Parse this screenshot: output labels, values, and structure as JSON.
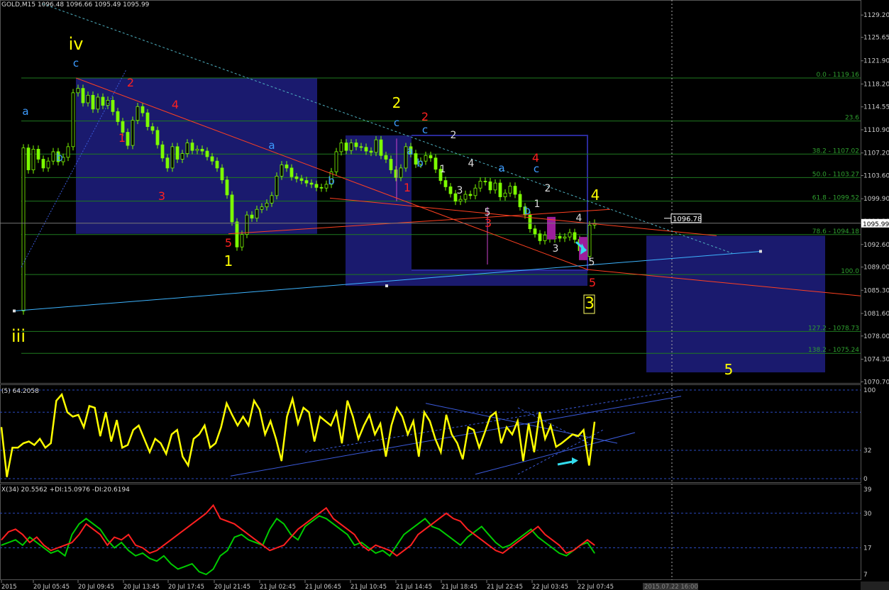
{
  "header": {
    "main": "GOLD,M15  1096.48 1096.66 1095.49 1095.99",
    "rsi": "(5) 64.2058",
    "adx": "X(34) 20.5562 +DI:15.0976 -DI:20.6194"
  },
  "chart_data": [
    {
      "type": "line",
      "panel": "price",
      "title": "GOLD,M15  1096.48 1096.66 1095.49 1095.99",
      "bid_label": "1095.99",
      "price_tag": "1096.78",
      "ylim": [
        1070.4,
        1131.6
      ],
      "yticks": [
        "1129.20",
        "1125.65",
        "1121.90",
        "1118.20",
        "1114.55",
        "1110.90",
        "1107.20",
        "1103.60",
        "1099.90",
        "1096.30",
        "1092.60",
        "1089.00",
        "1085.30",
        "1081.60",
        "1078.00",
        "1074.30",
        "1070.70"
      ],
      "ytick_values": [
        1129.2,
        1125.65,
        1121.9,
        1118.2,
        1114.55,
        1110.9,
        1107.2,
        1103.6,
        1099.9,
        1096.3,
        1092.6,
        1089.0,
        1085.3,
        1081.6,
        1078.0,
        1074.3,
        1070.7
      ],
      "xticks": [
        "2015",
        "20 Jul 05:45",
        "20 Jul 09:45",
        "20 Jul 13:45",
        "20 Jul 17:45",
        "20 Jul 21:45",
        "21 Jul 02:45",
        "21 Jul 06:45",
        "21 Jul 10:45",
        "21 Jul 14:45",
        "21 Jul 18:45",
        "21 Jul 22:45",
        "22 Jul 03:45",
        "22 Jul 07:45"
      ],
      "x_cursor_label": "2015.07.22 16:00",
      "close": [
        1082.0,
        1108.0,
        1104.5,
        1107.8,
        1106.2,
        1104.8,
        1105.9,
        1107.4,
        1105.8,
        1106.5,
        1108.2,
        1116.8,
        1117.5,
        1115.2,
        1116.4,
        1114.2,
        1116.1,
        1114.8,
        1115.6,
        1113.8,
        1112.2,
        1110.5,
        1108.4,
        1112.4,
        1114.6,
        1113.6,
        1111.4,
        1110.8,
        1108.5,
        1106.4,
        1104.8,
        1108.2,
        1106.2,
        1107.1,
        1108.8,
        1107.6,
        1107.8,
        1107.5,
        1106.6,
        1105.9,
        1104.8,
        1102.9,
        1100.5,
        1096.2,
        1092.2,
        1094.2,
        1097.3,
        1096.8,
        1098.2,
        1098.6,
        1099.2,
        1100.4,
        1103.5,
        1105.3,
        1104.8,
        1103.4,
        1103.1,
        1102.8,
        1102.4,
        1102.2,
        1101.7,
        1101.6,
        1102.2,
        1104.2,
        1107.4,
        1108.8,
        1107.6,
        1108.8,
        1108.2,
        1108.1,
        1107.5,
        1107.3,
        1109.3,
        1106.8,
        1106.2,
        1104.5,
        1103.3,
        1104.8,
        1108.2,
        1107.1,
        1105.4,
        1105.9,
        1106.8,
        1106.4,
        1104.6,
        1102.8,
        1101.8,
        1100.7,
        1099.5,
        1099.8,
        1100.6,
        1100.4,
        1101.6,
        1102.7,
        1102.6,
        1101.3,
        1102.4,
        1100.2,
        1100.8,
        1101.9,
        1100.6,
        1098.6,
        1097.3,
        1095.1,
        1094.3,
        1093.2,
        1094.1,
        1093.5,
        1093.9,
        1093.6,
        1093.8,
        1094.5,
        1093.4,
        1091.6,
        1090.7,
        1095.7,
        1096.0
      ],
      "fib_levels": [
        {
          "label": "0.0 - 1119.16",
          "value": 1119.16
        },
        {
          "label": "23.6",
          "value": 1112.3
        },
        {
          "label": "38.2 - 1107.02",
          "value": 1107.02
        },
        {
          "label": "50.0 - 1103.27",
          "value": 1103.27
        },
        {
          "label": "61.8 - 1099.52",
          "value": 1099.52
        },
        {
          "label": "78.6 - 1094.18",
          "value": 1094.18
        },
        {
          "label": "100.0",
          "value": 1087.8
        },
        {
          "label": "127.2 - 1078.73",
          "value": 1078.73
        },
        {
          "label": "138.2 - 1075.24",
          "value": 1075.24
        }
      ],
      "wave_labels": [
        {
          "text": "iv",
          "color": "#ffff00"
        },
        {
          "text": "iii",
          "color": "#ffff00"
        },
        {
          "text": "c",
          "color": "#3d9bff"
        },
        {
          "text": "a",
          "color": "#3d9bff"
        },
        {
          "text": "b",
          "color": "#3d9bff"
        },
        {
          "text": "2",
          "color": "#ff2020"
        },
        {
          "text": "4",
          "color": "#ff2020"
        },
        {
          "text": "1",
          "color": "#ff2020"
        },
        {
          "text": "3",
          "color": "#ff2020"
        },
        {
          "text": "5",
          "color": "#ff2020"
        },
        {
          "text": "1",
          "color": "#ffff00"
        },
        {
          "text": "a",
          "color": "#3d9bff"
        },
        {
          "text": "b",
          "color": "#3d9bff"
        },
        {
          "text": "2",
          "color": "#ffff00"
        },
        {
          "text": "c",
          "color": "#3d9bff"
        },
        {
          "text": "2",
          "color": "#ff2020"
        },
        {
          "text": "c",
          "color": "#3d9bff"
        },
        {
          "text": "a",
          "color": "#3d9bff"
        },
        {
          "text": "1",
          "color": "#ff2020"
        },
        {
          "text": "b",
          "color": "#3d9bff"
        },
        {
          "text": "2",
          "color": "#dddddd"
        },
        {
          "text": "1",
          "color": "#dddddd"
        },
        {
          "text": "4",
          "color": "#dddddd"
        },
        {
          "text": "3",
          "color": "#dddddd"
        },
        {
          "text": "5",
          "color": "#dddddd"
        },
        {
          "text": "3",
          "color": "#ff2020"
        },
        {
          "text": "a",
          "color": "#3d9bff"
        },
        {
          "text": "4",
          "color": "#ff2020"
        },
        {
          "text": "c",
          "color": "#3d9bff"
        },
        {
          "text": "2",
          "color": "#dddddd"
        },
        {
          "text": "1",
          "color": "#dddddd"
        },
        {
          "text": "b",
          "color": "#3d9bff"
        },
        {
          "text": "3",
          "color": "#dddddd"
        },
        {
          "text": "4",
          "color": "#dddddd"
        },
        {
          "text": "5",
          "color": "#dddddd"
        },
        {
          "text": "4",
          "color": "#ffff00"
        },
        {
          "text": "5",
          "color": "#ff2020"
        },
        {
          "text": "3",
          "color": "#ffff00"
        },
        {
          "text": "5",
          "color": "#ffff00"
        }
      ],
      "colors": {
        "candles": "#7CFC00",
        "fib": "#1f7a1f",
        "box": "#1a1a6e",
        "trend_red": "#ff4020",
        "trend_blue": "#3db4ff",
        "highlight": "#9b1f9b"
      }
    },
    {
      "type": "line",
      "panel": "rsi",
      "title": "(5) 64.2058",
      "ylim": [
        0,
        100
      ],
      "yticks": [
        "100",
        "32",
        "0"
      ],
      "ytick_values": [
        100,
        32,
        0
      ],
      "levels": [
        100,
        75,
        32,
        0
      ],
      "values": [
        58,
        2,
        35,
        35,
        40,
        42,
        38,
        45,
        35,
        40,
        88,
        95,
        75,
        70,
        72,
        58,
        82,
        80,
        48,
        75,
        42,
        66,
        35,
        38,
        55,
        60,
        45,
        30,
        45,
        40,
        28,
        50,
        55,
        25,
        15,
        45,
        50,
        60,
        35,
        40,
        58,
        85,
        72,
        60,
        70,
        60,
        88,
        78,
        50,
        65,
        45,
        20,
        70,
        90,
        62,
        80,
        75,
        42,
        70,
        65,
        60,
        75,
        40,
        88,
        70,
        45,
        60,
        72,
        50,
        62,
        25,
        60,
        80,
        70,
        50,
        65,
        25,
        75,
        65,
        45,
        30,
        72,
        50,
        40,
        22,
        58,
        55,
        35,
        52,
        70,
        75,
        40,
        58,
        50,
        65,
        20,
        62,
        30,
        75,
        45,
        60,
        36,
        40,
        45,
        50,
        48,
        55,
        15,
        64
      ]
    },
    {
      "type": "line",
      "panel": "adx",
      "title": "X(34) 20.5562 +DI:15.0976 -DI:20.6194",
      "ylim": [
        7,
        39
      ],
      "yticks": [
        "39",
        "30",
        "17",
        "7"
      ],
      "ytick_values": [
        39,
        30,
        17,
        7
      ],
      "levels": [
        30,
        17
      ],
      "series": [
        {
          "name": "+DI:15.0976",
          "color": "#00cc00",
          "values": [
            18,
            19,
            20,
            18,
            21,
            19,
            17,
            15,
            16,
            14,
            22,
            26,
            28,
            26,
            24,
            20,
            17,
            19,
            16,
            14,
            15,
            13,
            12,
            14,
            11,
            9,
            10,
            11,
            8,
            7,
            9,
            14,
            16,
            21,
            22,
            20,
            19,
            18,
            24,
            28,
            26,
            22,
            20,
            25,
            27,
            29,
            28,
            26,
            24,
            22,
            18,
            19,
            17,
            15,
            16,
            14,
            18,
            22,
            24,
            26,
            28,
            25,
            24,
            22,
            20,
            18,
            21,
            23,
            25,
            22,
            19,
            17,
            18,
            20,
            22,
            24,
            21,
            19,
            17,
            15,
            14,
            16,
            18,
            19,
            15
          ]
        },
        {
          "name": "-DI:20.6194",
          "color": "#ff2020",
          "values": [
            20,
            23,
            24,
            22,
            19,
            21,
            18,
            16,
            17,
            18,
            19,
            22,
            26,
            24,
            22,
            18,
            21,
            20,
            22,
            18,
            17,
            15,
            16,
            18,
            20,
            22,
            24,
            26,
            28,
            30,
            33,
            28,
            27,
            26,
            24,
            22,
            20,
            18,
            16,
            17,
            18,
            21,
            24,
            26,
            28,
            30,
            32,
            28,
            26,
            24,
            22,
            18,
            16,
            18,
            17,
            16,
            14,
            16,
            18,
            22,
            24,
            26,
            28,
            30,
            28,
            27,
            24,
            22,
            20,
            18,
            16,
            15,
            17,
            19,
            21,
            23,
            25,
            22,
            20,
            18,
            15,
            16,
            18,
            20,
            18
          ]
        }
      ]
    }
  ]
}
